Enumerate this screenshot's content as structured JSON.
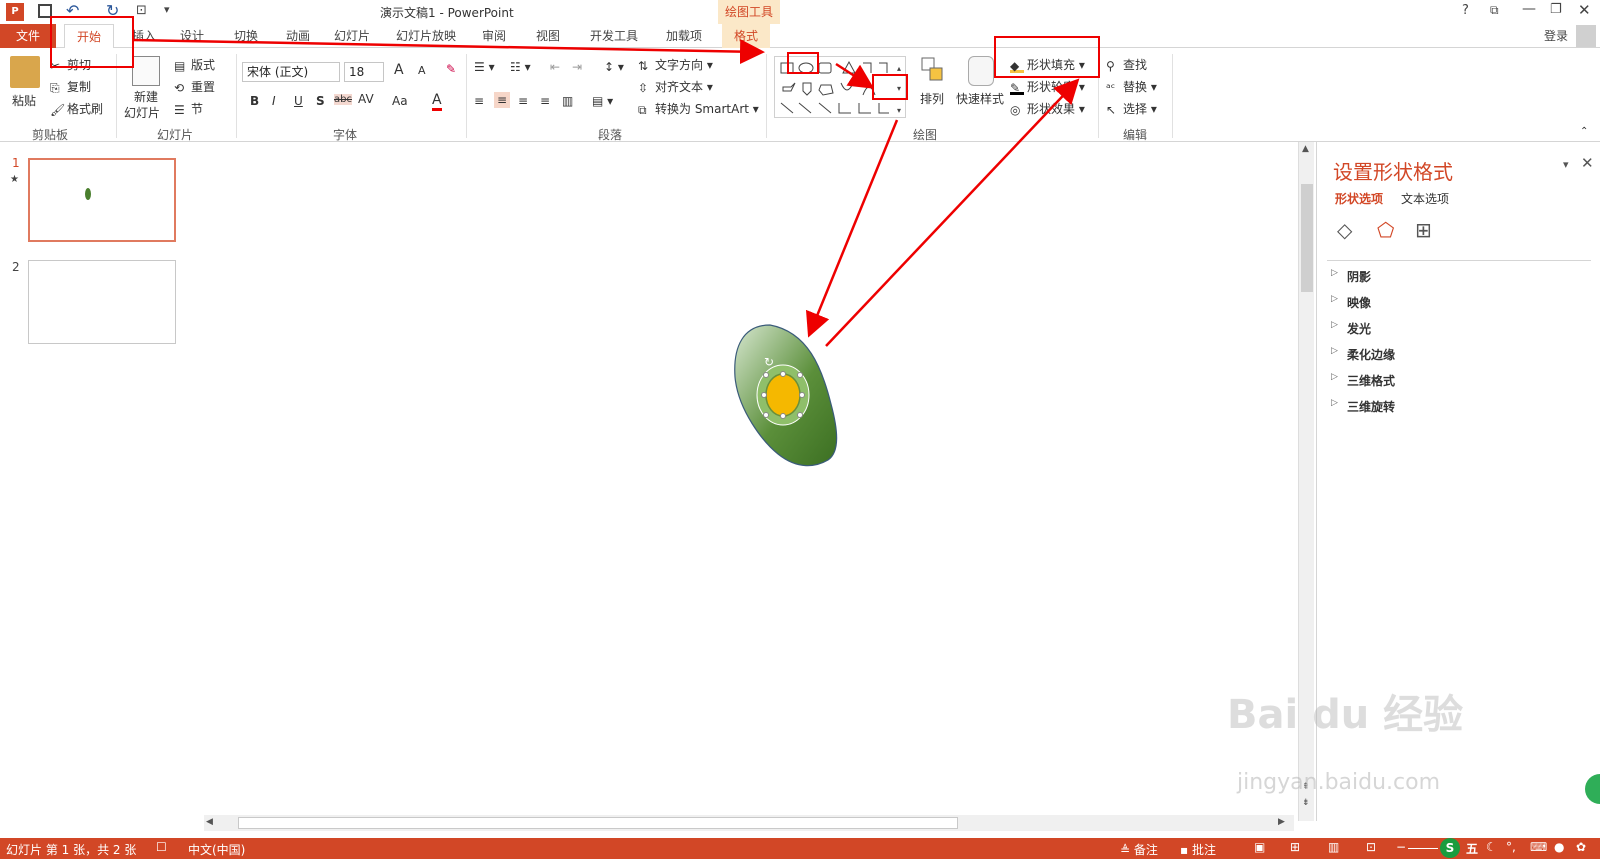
{
  "window": {
    "title": "演示文稿1 - PowerPoint",
    "drawing_tools": "绘图工具",
    "help": "?",
    "login": "登录"
  },
  "tabs": [
    "文件",
    "开始",
    "插入",
    "设计",
    "切换",
    "动画",
    "幻灯片放映",
    "审阅",
    "视图",
    "开发工具",
    "加载项",
    "格式"
  ],
  "clipboard": {
    "paste": "粘贴",
    "cut": "剪切",
    "copy": "复制",
    "format_painter": "格式刷",
    "label": "剪贴板"
  },
  "slides": {
    "new_slide_l1": "新建",
    "new_slide_l2": "幻灯片",
    "layout": "版式",
    "reset": "重置",
    "section": "节",
    "label": "幻灯片"
  },
  "font": {
    "name": "宋体 (正文)",
    "size": "18",
    "bold": "B",
    "italic": "I",
    "underline": "U",
    "shadow": "S",
    "strike": "abc",
    "spacing": "AV",
    "case": "Aa",
    "color": "A",
    "grow": "A",
    "shrink": "A",
    "label": "字体"
  },
  "paragraph": {
    "text_direction": "文字方向",
    "align_text": "对齐文本",
    "smartart": "转换为 SmartArt",
    "label": "段落"
  },
  "drawing": {
    "arrange": "排列",
    "quick_styles": "快速样式",
    "fill": "形状填充",
    "outline": "形状轮廓",
    "effects": "形状效果",
    "label": "绘图"
  },
  "editing": {
    "find": "查找",
    "replace": "替换",
    "select": "选择",
    "label": "编辑"
  },
  "slide_thumbs": [
    "1",
    "2"
  ],
  "format_pane": {
    "title": "设置形状格式",
    "tab_shape": "形状选项",
    "tab_text": "文本选项",
    "sections": [
      "阴影",
      "映像",
      "发光",
      "柔化边缘",
      "三维格式",
      "三维旋转"
    ]
  },
  "status": {
    "slide_info": "幻灯片 第 1 张，共 2 张",
    "language": "中文(中国)",
    "notes": "备注",
    "comments": "批注",
    "ime": "五"
  },
  "watermark": {
    "brand": "Bai du 经验",
    "url": "jingyan.baidu.com"
  },
  "colors": {
    "accent": "#d24726",
    "annotation": "#e00000",
    "shape_green": "#4a7f2e",
    "shape_yellow": "#f5b800"
  }
}
